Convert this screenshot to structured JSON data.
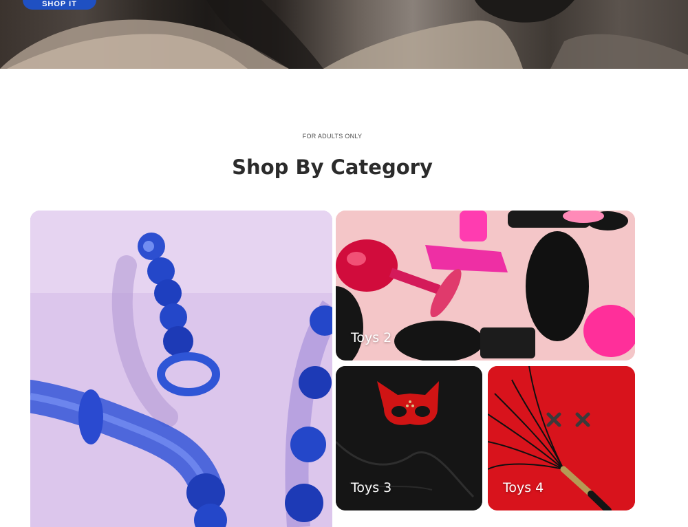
{
  "hero": {
    "button_label": "SHOP IT"
  },
  "section": {
    "eyebrow": "FOR ADULTS ONLY",
    "title": "Shop By Category"
  },
  "categories": [
    {
      "label": "",
      "image": "blue-glass-toys-image"
    },
    {
      "label": "Toys 2",
      "image": "pink-black-plugs-image"
    },
    {
      "label": "Toys 3",
      "image": "red-cat-mask-whip-image"
    },
    {
      "label": "Toys 4",
      "image": "flogger-red-background-image"
    }
  ],
  "colors": {
    "accent": "#1f50c2",
    "title": "#2b2b2b",
    "tile_1_bg": "#dcc6ec",
    "tile_2_bg": "#f4c6c8",
    "tile_3_bg": "#151515",
    "tile_4_bg": "#d8131c"
  }
}
